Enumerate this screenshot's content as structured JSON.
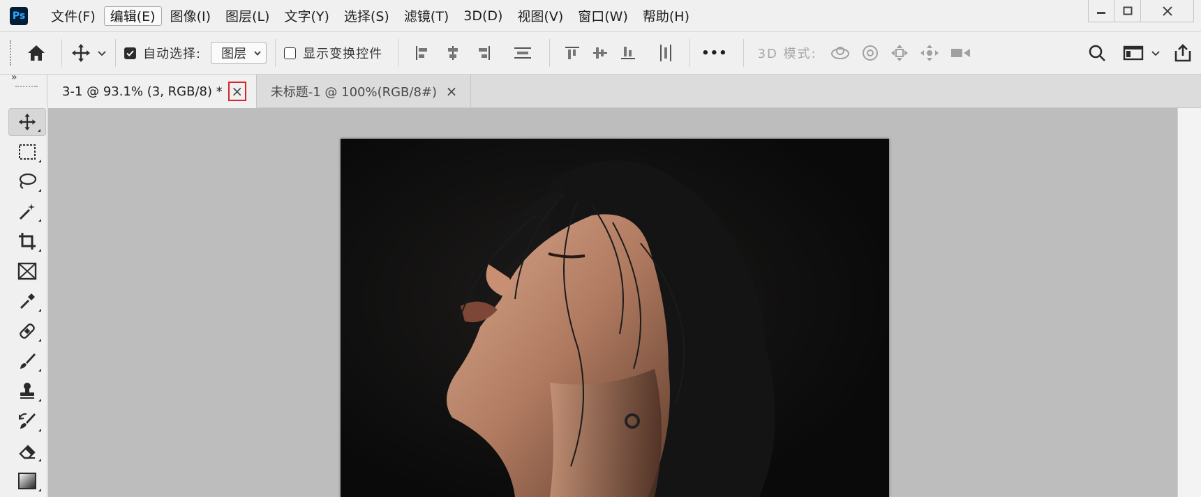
{
  "app": {
    "logo_text": "Ps",
    "accent": "#31a8ff"
  },
  "menu": {
    "items": [
      {
        "label": "文件(F)"
      },
      {
        "label": "编辑(E)"
      },
      {
        "label": "图像(I)"
      },
      {
        "label": "图层(L)"
      },
      {
        "label": "文字(Y)"
      },
      {
        "label": "选择(S)"
      },
      {
        "label": "滤镜(T)"
      },
      {
        "label": "3D(D)"
      },
      {
        "label": "视图(V)"
      },
      {
        "label": "窗口(W)"
      },
      {
        "label": "帮助(H)"
      }
    ],
    "active_label": "编辑(E)"
  },
  "window_controls": {
    "minimize": "minimize-icon",
    "maximize": "maximize-icon",
    "close": "close-icon"
  },
  "options": {
    "auto_select_label": "自动选择:",
    "auto_select_checked": true,
    "layer_select_value": "图层",
    "show_transform_label": "显示变换控件",
    "show_transform_checked": false,
    "mode_label": "3D 模式:",
    "more": "•••"
  },
  "tools": [
    "move-tool",
    "marquee-tool",
    "lasso-tool",
    "magic-wand-tool",
    "crop-tool",
    "frame-tool",
    "eyedropper-tool",
    "healing-brush-tool",
    "brush-tool",
    "clone-stamp-tool",
    "history-brush-tool",
    "eraser-tool",
    "gradient-tool"
  ],
  "toolbar": {
    "collapse": "»",
    "active_tool": "move-tool"
  },
  "tabs": [
    {
      "label": "3-1 @ 93.1% (3, RGB/8) *",
      "active": true,
      "close": "×",
      "close_highlighted": true
    },
    {
      "label": "未标题-1 @ 100%(RGB/8#)",
      "active": false,
      "close": "×"
    }
  ],
  "colors": {
    "highlight_border": "#d9232e",
    "canvas_bg": "#bdbdbd",
    "ui_bg": "#f0f0f0"
  }
}
